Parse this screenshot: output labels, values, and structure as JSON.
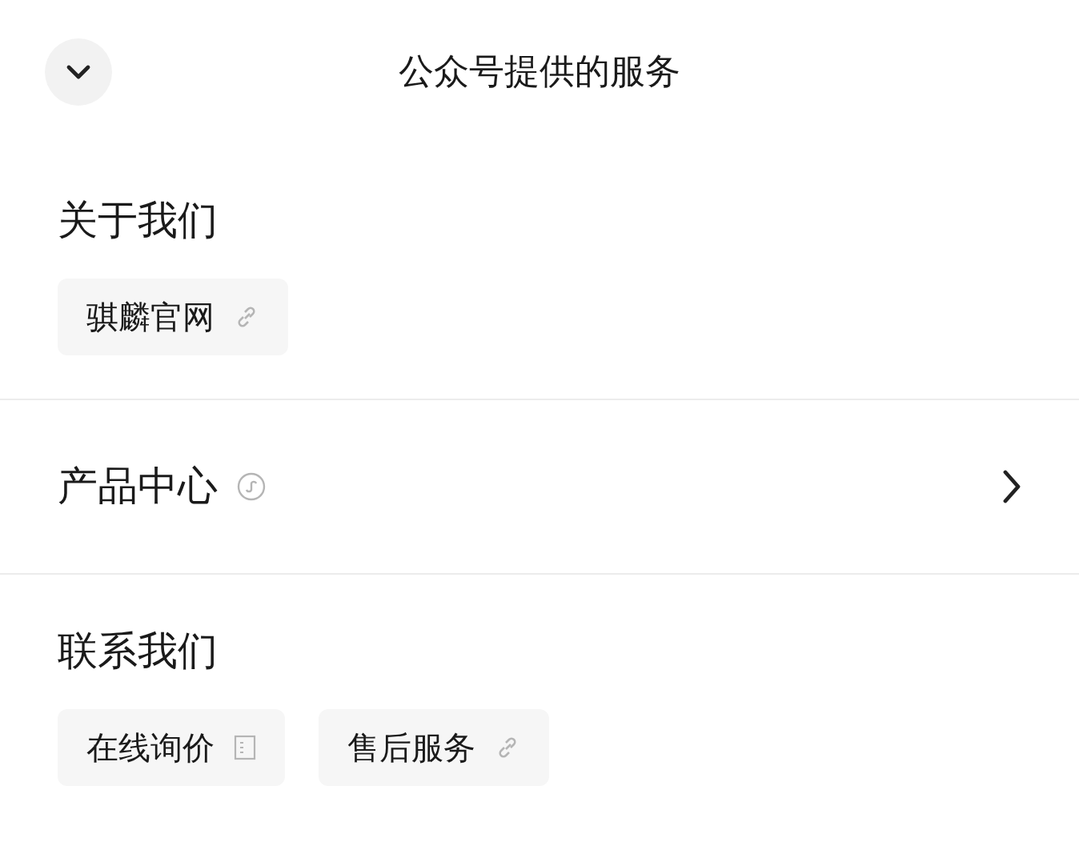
{
  "header": {
    "title": "公众号提供的服务"
  },
  "sections": [
    {
      "kind": "group",
      "title": "关于我们",
      "items": [
        {
          "label": "骐麟官网",
          "kind": "link"
        }
      ]
    },
    {
      "kind": "miniprogram",
      "title": "产品中心"
    },
    {
      "kind": "group",
      "title": "联系我们",
      "items": [
        {
          "label": "在线询价",
          "kind": "form"
        },
        {
          "label": "售后服务",
          "kind": "link"
        }
      ]
    }
  ]
}
